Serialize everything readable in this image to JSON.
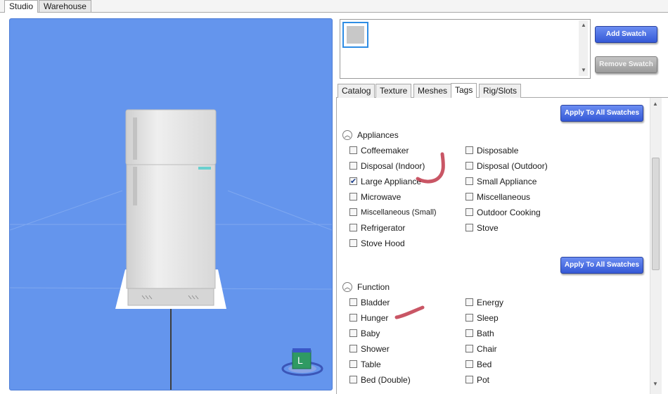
{
  "top_tabs": [
    "Studio",
    "Warehouse"
  ],
  "viewport": {
    "badge_letter": "L"
  },
  "swatch": {
    "add_label": "Add Swatch",
    "remove_label": "Remove Swatch"
  },
  "panel_tabs": [
    "Catalog",
    "Texture",
    "Meshes",
    "Tags",
    "Rig/Slots"
  ],
  "apply_all_label": "Apply To All Swatches",
  "sections": {
    "appliances": {
      "title": "Appliances",
      "items": [
        {
          "label": "Coffeemaker",
          "checked": false
        },
        {
          "label": "Disposable",
          "checked": false
        },
        {
          "label": "Disposal (Indoor)",
          "checked": false
        },
        {
          "label": "Disposal (Outdoor)",
          "checked": false
        },
        {
          "label": "Large Appliance",
          "checked": true
        },
        {
          "label": "Small Appliance",
          "checked": false
        },
        {
          "label": "Microwave",
          "checked": false
        },
        {
          "label": "Miscellaneous",
          "checked": false
        },
        {
          "label": "Miscellaneous (Small)",
          "checked": false
        },
        {
          "label": "Outdoor Cooking",
          "checked": false
        },
        {
          "label": "Refrigerator",
          "checked": false
        },
        {
          "label": "Stove",
          "checked": false
        },
        {
          "label": "Stove Hood",
          "checked": false
        }
      ]
    },
    "function": {
      "title": "Function",
      "items": [
        {
          "label": "Bladder",
          "checked": false
        },
        {
          "label": "Energy",
          "checked": false
        },
        {
          "label": "Hunger",
          "checked": false
        },
        {
          "label": "Sleep",
          "checked": false
        },
        {
          "label": "Baby",
          "checked": false
        },
        {
          "label": "Bath",
          "checked": false
        },
        {
          "label": "Shower",
          "checked": false
        },
        {
          "label": "Chair",
          "checked": false
        },
        {
          "label": "Table",
          "checked": false
        },
        {
          "label": "Bed",
          "checked": false
        },
        {
          "label": "Bed (Double)",
          "checked": false
        },
        {
          "label": "Pot",
          "checked": false
        }
      ]
    }
  },
  "colors": {
    "viewport_bg": "#6495ed",
    "button_blue": "#3d63dd",
    "swatch_border": "#2f8de4",
    "annotation_red": "#c0384a"
  }
}
